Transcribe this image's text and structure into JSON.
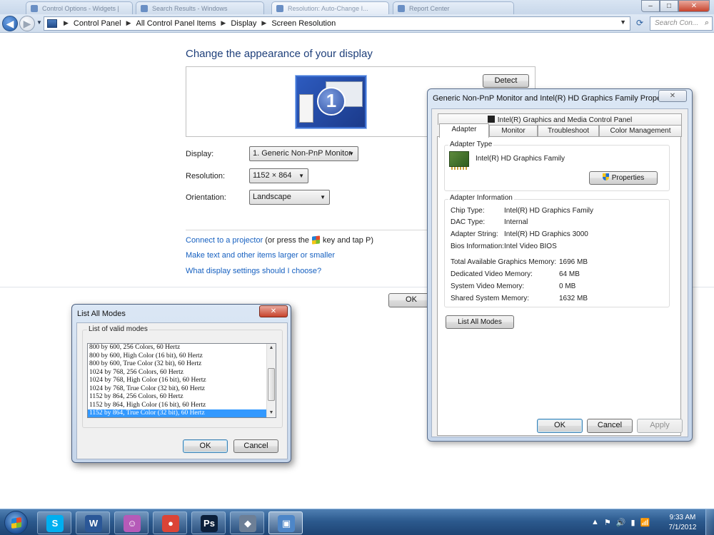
{
  "browser": {
    "tabs": [
      {
        "label": "Control Options - Widgets |"
      },
      {
        "label": "Search Results - Windows"
      },
      {
        "label": "Resolution: Auto-Change I..."
      },
      {
        "label": "Report Center"
      }
    ],
    "window_controls": {
      "minimize": "–",
      "maximize": "□",
      "close": "✕"
    }
  },
  "address": {
    "crumbs": [
      "Control Panel",
      "All Control Panel Items",
      "Display",
      "Screen Resolution"
    ],
    "search_placeholder": "Search Con..."
  },
  "page": {
    "heading": "Change the appearance of your display",
    "detect_label": "Detect",
    "monitor_number": "1",
    "display_label": "Display:",
    "display_value": "1. Generic Non-PnP Monitor",
    "resolution_label": "Resolution:",
    "resolution_value": "1152 × 864",
    "orientation_label": "Orientation:",
    "orientation_value": "Landscape",
    "link_projector": "Connect to a projector",
    "link_projector_suffix_a": "(or press the",
    "link_projector_suffix_b": "key and tap P)",
    "link_text_size": "Make text and other items larger or smaller",
    "link_settings": "What display settings should I choose?",
    "ok_label": "OK"
  },
  "properties": {
    "title": "Generic Non-PnP Monitor and Intel(R) HD Graphics Family Properti...",
    "close_glyph": "✕",
    "top_tab": "Intel(R) Graphics and Media Control Panel",
    "tabs": [
      "Adapter",
      "Monitor",
      "Troubleshoot",
      "Color Management"
    ],
    "adapter_type_label": "Adapter Type",
    "adapter_name": "Intel(R) HD Graphics Family",
    "properties_button": "Properties",
    "adapter_info_label": "Adapter Information",
    "info": [
      {
        "key": "Chip Type:",
        "value": "Intel(R) HD Graphics Family"
      },
      {
        "key": "DAC Type:",
        "value": "Internal"
      },
      {
        "key": "Adapter String:",
        "value": "Intel(R) HD Graphics 3000"
      },
      {
        "key": "Bios Information:",
        "value": "Intel Video BIOS"
      }
    ],
    "memory": [
      {
        "key": "Total Available Graphics Memory:",
        "value": "1696 MB"
      },
      {
        "key": "Dedicated Video Memory:",
        "value": "64 MB"
      },
      {
        "key": "System Video Memory:",
        "value": "0 MB"
      },
      {
        "key": "Shared System Memory:",
        "value": "1632 MB"
      }
    ],
    "list_all_modes": "List All Modes",
    "ok": "OK",
    "cancel": "Cancel",
    "apply": "Apply"
  },
  "modes": {
    "title": "List All Modes",
    "close_glyph": "✕",
    "group_label": "List of valid modes",
    "items": [
      "800 by 600, 256 Colors, 60 Hertz",
      "800 by 600, High Color (16 bit), 60 Hertz",
      "800 by 600, True Color (32 bit), 60 Hertz",
      "1024 by 768, 256 Colors, 60 Hertz",
      "1024 by 768, High Color (16 bit), 60 Hertz",
      "1024 by 768, True Color (32 bit), 60 Hertz",
      "1152 by 864, 256 Colors, 60 Hertz",
      "1152 by 864, High Color (16 bit), 60 Hertz",
      "1152 by 864, True Color (32 bit), 60 Hertz"
    ],
    "selected_item": "1152 by 864, True Color (32 bit), 60 Hertz",
    "ok": "OK",
    "cancel": "Cancel"
  },
  "taskbar": {
    "apps": [
      {
        "name": "skype",
        "glyph": "S",
        "color": "#00aff0"
      },
      {
        "name": "word",
        "glyph": "W",
        "color": "#2b5797"
      },
      {
        "name": "messenger",
        "glyph": "☺",
        "color": "#b55ab8"
      },
      {
        "name": "chrome",
        "glyph": "●",
        "color": "#db4437"
      },
      {
        "name": "photoshop",
        "glyph": "Ps",
        "color": "#0b1f3a"
      },
      {
        "name": "virtualbox",
        "glyph": "◆",
        "color": "#6d7f96"
      },
      {
        "name": "control-panel",
        "glyph": "▣",
        "color": "#4d86c8"
      }
    ],
    "tray_icons": [
      "▲",
      "⚑",
      "🔊",
      "▮",
      "📶"
    ],
    "time": "9:33 AM",
    "date": "7/1/2012"
  }
}
